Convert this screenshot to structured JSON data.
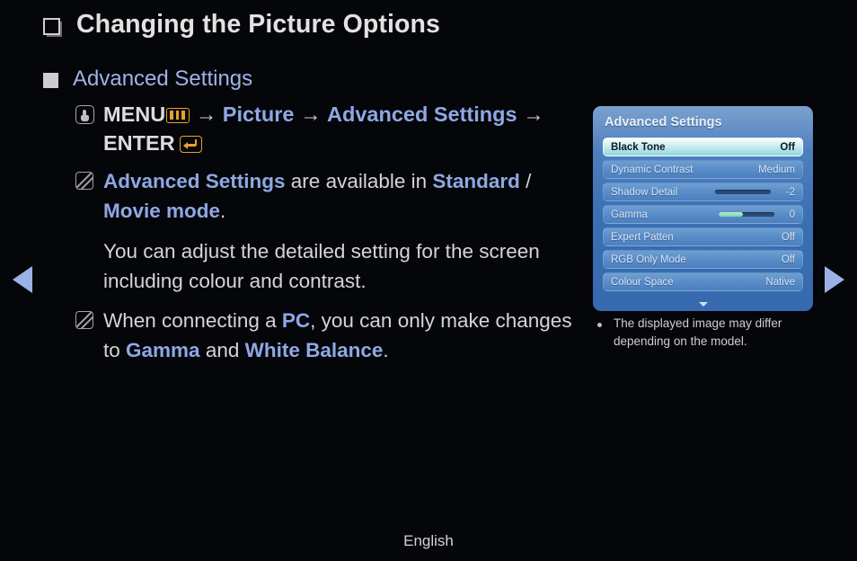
{
  "page": {
    "title": "Changing the Picture Options",
    "footer_language": "English"
  },
  "nav": {
    "prev_icon": "triangle-left-icon",
    "next_icon": "triangle-right-icon"
  },
  "section": {
    "heading": "Advanced Settings",
    "menu_path": {
      "icon": "hand-press-icon",
      "menu_label": "MENU",
      "menu_key_icon": "menu-key-icon",
      "arrow1": "→",
      "step1": "Picture",
      "arrow2": "→",
      "step2": "Advanced Settings",
      "arrow3": "→",
      "enter_label": "ENTER",
      "enter_key_icon": "enter-key-icon"
    },
    "note1": {
      "icon": "note-pencil-icon",
      "part1": "Advanced Settings",
      "part2": " are available in ",
      "part3": "Standard",
      "part4": " / ",
      "part5": "Movie mode",
      "part6": "."
    },
    "body": "You can adjust the detailed setting for the screen including colour and contrast.",
    "note2": {
      "icon": "note-pencil-icon",
      "part1": "When connecting a ",
      "part2": "PC",
      "part3": ", you can only make changes to ",
      "part4": "Gamma",
      "part5": " and ",
      "part6": "White Balance",
      "part7": "."
    }
  },
  "osd": {
    "title": "Advanced Settings",
    "rows": [
      {
        "label": "Black Tone",
        "value": "Off",
        "selected": true,
        "slider": null
      },
      {
        "label": "Dynamic Contrast",
        "value": "Medium",
        "selected": false,
        "slider": null
      },
      {
        "label": "Shadow Detail",
        "value": "-2",
        "selected": false,
        "slider": 0
      },
      {
        "label": "Gamma",
        "value": "0",
        "selected": false,
        "slider": 45
      },
      {
        "label": "Expert Patten",
        "value": "Off",
        "selected": false,
        "slider": null
      },
      {
        "label": "RGB Only Mode",
        "value": "Off",
        "selected": false,
        "slider": null
      },
      {
        "label": "Colour Space",
        "value": "Native",
        "selected": false,
        "slider": null
      }
    ],
    "more_icon": "chevron-down-icon"
  },
  "caption": {
    "bullet": "bullet-dot-icon",
    "text": "The displayed image may differ depending on the model."
  },
  "colors": {
    "background": "#05060a",
    "body_text": "#d5d5d5",
    "accent_blue": "#8fa8e4",
    "accent_orange": "#e8a12a",
    "osd_blue": "#3b6fb4",
    "osd_selected": "#a9e0e8",
    "slider_fill": "#7fd3ae"
  }
}
